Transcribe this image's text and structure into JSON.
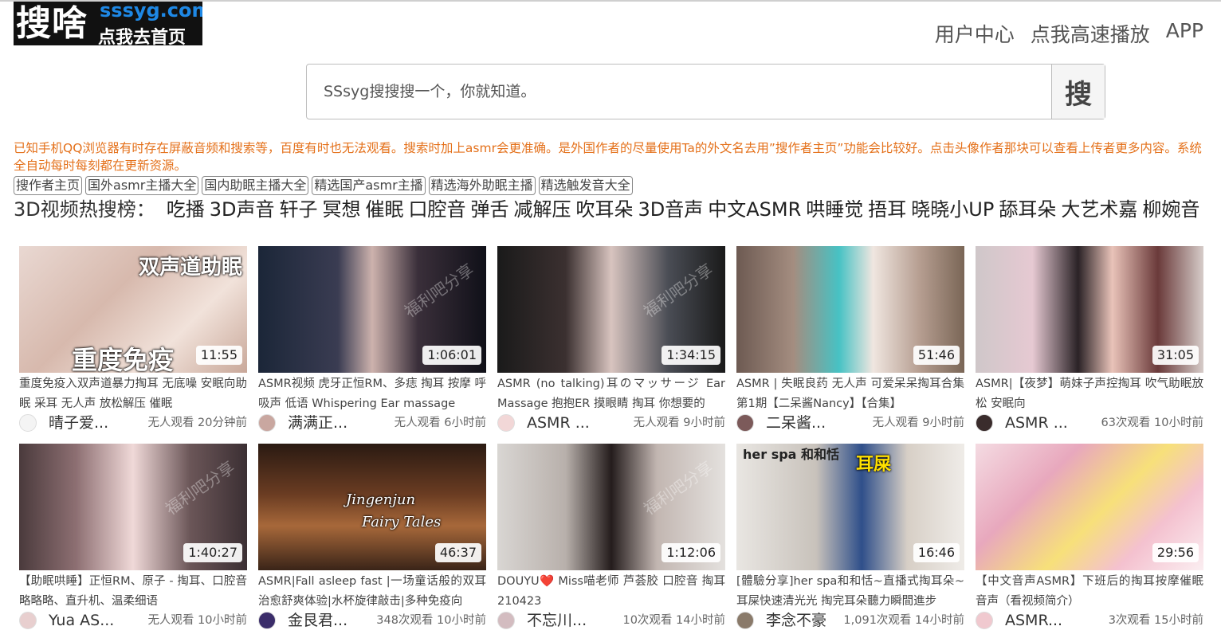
{
  "logo": {
    "big": "搜啥",
    "domain": "sssyg.com",
    "sub": "点我去首页"
  },
  "topnav": [
    "用户中心",
    "点我高速播放",
    "APP"
  ],
  "search": {
    "placeholder": "SSsyg搜搜搜一个，你就知道。",
    "button": "搜"
  },
  "notice": "已知手机QQ浏览器有时存在屏蔽音频和搜索等，百度有时也无法观看。搜索时加上asmr会更准确。是外国作者的尽量使用Ta的外文名去用”搜作者主页”功能会比较好。点击头像作者那块可以查看上传者更多内容。系统全自动每时每刻都在更新资源。",
  "tags": [
    "搜作者主页",
    "国外asmr主播大全",
    "国内助眠主播大全",
    "精选国产asmr主播",
    "精选海外助眠主播",
    "精选触发音大全"
  ],
  "hot": {
    "label": "3D视频热搜榜：",
    "items": [
      "吃播",
      "3D声音",
      "轩子",
      "冥想",
      "催眠",
      "口腔音",
      "弹舌",
      "减解压",
      "吹耳朵",
      "3D音声",
      "中文ASMR",
      "哄睡觉",
      "捂耳",
      "晓晓小UP",
      "舔耳朵",
      "大艺术嘉",
      "柳婉音"
    ]
  },
  "videos": [
    {
      "duration": "11:55",
      "title": "重度免疫入双声道暴力掏耳 无底噪 安眠向助眠 采耳 无人声 放松解压 催眠",
      "author": "晴子爱...",
      "stats": "无人观看 20分钟前",
      "overlay": "双声道助眠",
      "overlay2": "重度免疫"
    },
    {
      "duration": "1:06:01",
      "title": "ASMR视频 虎牙正恒RM、多痣 掏耳 按摩 呼吸声 低语 Whispering Ear massage",
      "author": "满满正...",
      "stats": "无人观看 6小时前",
      "overlay": "福利吧分享",
      "overlay2": ""
    },
    {
      "duration": "1:34:15",
      "title": "ASMR (no talking)耳のマッサージ Ear Massage 抱抱ER 摸眼睛 掏耳 你想要的",
      "author": "ASMR ...",
      "stats": "无人观看 9小时前",
      "overlay": "福利吧分享",
      "overlay2": ""
    },
    {
      "duration": "51:46",
      "title": "ASMR | 失眠良药 无人声 可爱呆呆掏耳合集 第1期【二呆酱Nancy】【合集】",
      "author": "二呆酱...",
      "stats": "无人观看 9小时前",
      "overlay": "",
      "overlay2": ""
    },
    {
      "duration": "31:05",
      "title": "ASMR|【夜梦】萌妹子声控掏耳 吹气助眠放松 安眠向",
      "author": "ASMR ...",
      "stats": "63次观看 10小时前",
      "overlay": "",
      "overlay2": ""
    },
    {
      "duration": "1:40:27",
      "title": "【助眠哄睡】正恒RM、原子 - 掏耳、口腔音 略略略、直升机、温柔细语",
      "author": "Yua AS...",
      "stats": "无人观看 10小时前",
      "overlay": "福利吧分享",
      "overlay2": ""
    },
    {
      "duration": "46:37",
      "title": "ASMR|Fall asleep fast |一场童话般的双耳治愈舒爽体验|水杯旋律敲击|多种免疫向",
      "author": "金艮君...",
      "stats": "348次观看 10小时前",
      "overlay": "Jingenjun",
      "overlay2": "Fairy Tales"
    },
    {
      "duration": "1:12:06",
      "title": "DOUYU❤️ Miss喵老师 芦荟胶 口腔音 掏耳 210423",
      "author": "不忘川...",
      "stats": "10次观看 14小时前",
      "overlay": "福利吧分享",
      "overlay2": ""
    },
    {
      "duration": "16:46",
      "title": "[體驗分享]her spa和和恬~直播式掏耳朵~耳屎快速清光光 掏完耳朵聽力瞬間進步",
      "author": "李念不豪",
      "stats": "1,091次观看 14小时前",
      "overlay": "her spa 和和恬",
      "overlay2": "耳屎"
    },
    {
      "duration": "29:56",
      "title": "【中文音声ASMR】下班后的掏耳按摩催眠音声（看视频简介）",
      "author": "ASMR...",
      "stats": "3次观看 15小时前",
      "overlay": "",
      "overlay2": ""
    }
  ]
}
